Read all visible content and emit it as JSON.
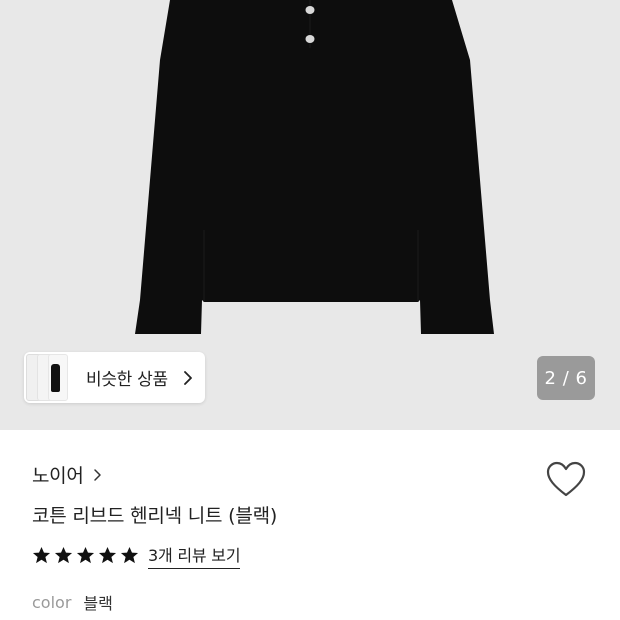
{
  "gallery": {
    "similar_label": "비슷한 상품",
    "counter": "2 / 6"
  },
  "product": {
    "brand": "노이어",
    "title": "코튼 리브드 헨리넥 니트 (블랙)",
    "rating_stars": 5,
    "review_link": "3개 리뷰 보기",
    "option_key": "color",
    "option_value": "블랙"
  },
  "colors": {
    "gallery_bg": "#e8e8e8",
    "garment": "#0d0d0d",
    "counter_bg": "#9a9a9a",
    "text": "#222222",
    "muted": "#9a9a9a"
  },
  "icons": {
    "similar_chevron": "chevron-right-icon",
    "brand_chevron": "chevron-right-icon",
    "wishlist": "heart-outline-icon",
    "star": "star-filled-icon"
  }
}
